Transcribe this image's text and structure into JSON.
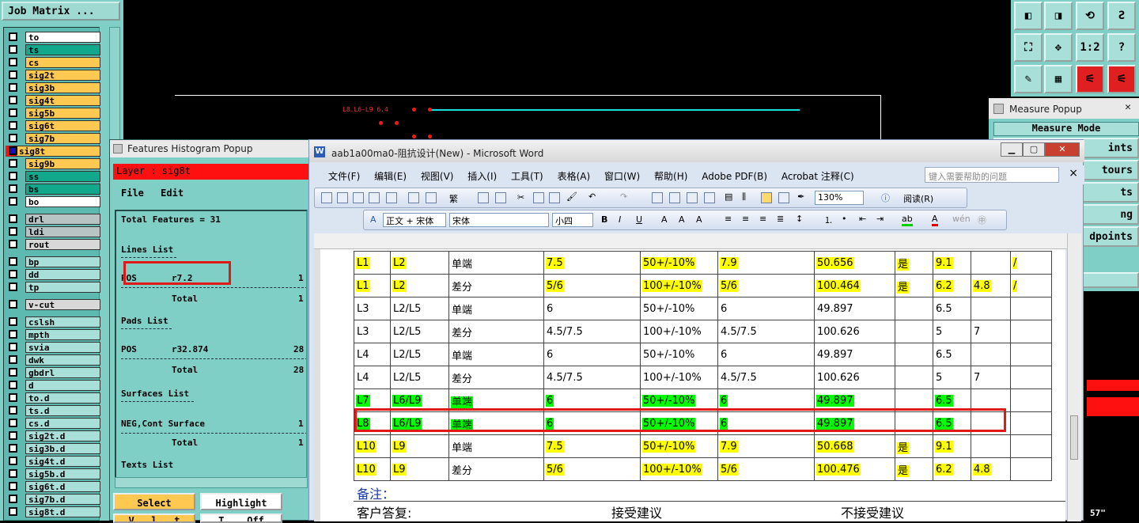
{
  "job_matrix": {
    "title": "Job Matrix ...",
    "groups": [
      {
        "layers": [
          {
            "name": "to",
            "color": "#ffffff"
          },
          {
            "name": "ts",
            "color": "#12a88c"
          },
          {
            "name": "cs",
            "color": "#ffc850"
          },
          {
            "name": "sig2t",
            "color": "#ffc850"
          },
          {
            "name": "sig3b",
            "color": "#ffc850"
          },
          {
            "name": "sig4t",
            "color": "#ffc850"
          },
          {
            "name": "sig5b",
            "color": "#ffc850"
          },
          {
            "name": "sig6t",
            "color": "#ffc850"
          },
          {
            "name": "sig7b",
            "color": "#ffc850"
          },
          {
            "name": "sig8t",
            "color": "#ffc850",
            "selected": true
          },
          {
            "name": "sig9b",
            "color": "#ffc850"
          },
          {
            "name": "ss",
            "color": "#12a88c"
          },
          {
            "name": "bs",
            "color": "#12a88c"
          },
          {
            "name": "bo",
            "color": "#ffffff"
          }
        ]
      },
      {
        "layers": [
          {
            "name": "drl",
            "color": "#b8c4c4"
          },
          {
            "name": "ldi",
            "color": "#b8c4c4"
          },
          {
            "name": "rout",
            "color": "#d8d8d8"
          }
        ]
      },
      {
        "layers": [
          {
            "name": "bp",
            "color": "#a8e0d9"
          },
          {
            "name": "dd",
            "color": "#a8e0d9"
          },
          {
            "name": "tp",
            "color": "#a8e0d9"
          }
        ]
      },
      {
        "layers": [
          {
            "name": "v-cut",
            "color": "#d8d8d8"
          }
        ]
      },
      {
        "layers": [
          {
            "name": "cslsh",
            "color": "#a8e0d9"
          },
          {
            "name": "mpth",
            "color": "#a8e0d9"
          },
          {
            "name": "svia",
            "color": "#a8e0d9"
          },
          {
            "name": "dwk",
            "color": "#a8e0d9"
          },
          {
            "name": "gbdrl",
            "color": "#a8e0d9"
          },
          {
            "name": "d",
            "color": "#a8e0d9"
          },
          {
            "name": "to.d",
            "color": "#a8e0d9"
          },
          {
            "name": "ts.d",
            "color": "#a8e0d9"
          },
          {
            "name": "cs.d",
            "color": "#a8e0d9"
          },
          {
            "name": "sig2t.d",
            "color": "#a8e0d9"
          },
          {
            "name": "sig3b.d",
            "color": "#a8e0d9"
          },
          {
            "name": "sig4t.d",
            "color": "#a8e0d9"
          },
          {
            "name": "sig5b.d",
            "color": "#a8e0d9"
          },
          {
            "name": "sig6t.d",
            "color": "#a8e0d9"
          },
          {
            "name": "sig7b.d",
            "color": "#a8e0d9"
          },
          {
            "name": "sig8t.d",
            "color": "#a8e0d9"
          }
        ]
      }
    ]
  },
  "canvas": {
    "annotation": "L8.L6-L9 6.4"
  },
  "histogram": {
    "title": "Features Histogram Popup",
    "layer_label": "Layer :  sig8t",
    "menu": [
      "File",
      "Edit"
    ],
    "total_features": "Total Features = 31",
    "lines_list": "Lines List",
    "lines_row_label": "POS",
    "lines_row_value": "r7.2",
    "lines_row_count": "1",
    "lines_total_label": "Total",
    "lines_total_value": "1",
    "pads_list": "Pads List",
    "pads_row_label": "POS",
    "pads_row_value": "r32.874",
    "pads_row_count": "28",
    "pads_total_label": "Total",
    "pads_total_value": "28",
    "surfaces_list": "Surfaces List",
    "surf_row_label": "NEG,Cont Surface",
    "surf_row_count": "1",
    "surf_total_label": "Total",
    "surf_total_value": "1",
    "texts_list": "Texts List",
    "btn_select": "Select",
    "btn_highlight": "Highlight",
    "btn_partial1": "V...l...t",
    "btn_partial2": "T... Off"
  },
  "measure": {
    "title": "Measure Popup",
    "mode": "Measure Mode",
    "buttons": [
      "ints",
      "tours",
      "ts",
      "ng",
      "dpoints"
    ],
    "bottom_text": "57\""
  },
  "word": {
    "title": "aab1a00ma0-阻抗设计(New) - Microsoft Word",
    "menu": [
      "文件(F)",
      "编辑(E)",
      "视图(V)",
      "插入(I)",
      "工具(T)",
      "表格(A)",
      "窗口(W)",
      "帮助(H)",
      "Adobe PDF(B)",
      "Acrobat 注释(C)"
    ],
    "help_placeholder": "键入需要帮助的问题",
    "zoom": "130%",
    "read_mode": "阅读(R)",
    "style": "正文 + 宋体",
    "font": "宋体",
    "size": "小四",
    "table_rows": [
      [
        "L1",
        "L2",
        "单端",
        "7.5",
        "50+/-10%",
        "7.9",
        "50.656",
        "是",
        "9.1",
        "",
        "/"
      ],
      [
        "L1",
        "L2",
        "差分",
        "5/6",
        "100+/-10%",
        "5/6",
        "100.464",
        "是",
        "6.2",
        "4.8",
        "/"
      ],
      [
        "L3",
        "L2/L5",
        "单端",
        "6",
        "50+/-10%",
        "6",
        "49.897",
        "",
        "6.5",
        "",
        ""
      ],
      [
        "L3",
        "L2/L5",
        "差分",
        "4.5/7.5",
        "100+/-10%",
        "4.5/7.5",
        "100.626",
        "",
        "5",
        "7",
        ""
      ],
      [
        "L4",
        "L2/L5",
        "单端",
        "6",
        "50+/-10%",
        "6",
        "49.897",
        "",
        "6.5",
        "",
        ""
      ],
      [
        "L4",
        "L2/L5",
        "差分",
        "4.5/7.5",
        "100+/-10%",
        "4.5/7.5",
        "100.626",
        "",
        "5",
        "7",
        ""
      ],
      [
        "L7",
        "L6/L9",
        "单端",
        "6",
        "50+/-10%",
        "6",
        "49.897",
        "",
        "6.5",
        "",
        ""
      ],
      [
        "L8",
        "L6/L9",
        "单端",
        "6",
        "50+/-10%",
        "6",
        "49.897",
        "",
        "6.5",
        "",
        ""
      ],
      [
        "L10",
        "L9",
        "单端",
        "7.5",
        "50+/-10%",
        "7.9",
        "50.668",
        "是",
        "9.1",
        "",
        ""
      ],
      [
        "L10",
        "L9",
        "差分",
        "5/6",
        "100+/-10%",
        "5/6",
        "100.476",
        "是",
        "6.2",
        "4.8",
        ""
      ]
    ],
    "row_highlight": [
      "yel",
      "yel",
      "none",
      "none",
      "none",
      "none",
      "grn",
      "grn",
      "yel",
      "yel"
    ],
    "remark": "备注：",
    "customer_reply": "客户答复:",
    "accept": "接受建议",
    "reject": "不接受建议"
  },
  "colors": {
    "panel": "#7fcfc6",
    "highlight_yellow": "#ffff00",
    "highlight_green": "#00ff00",
    "callout_red": "#e01818"
  }
}
